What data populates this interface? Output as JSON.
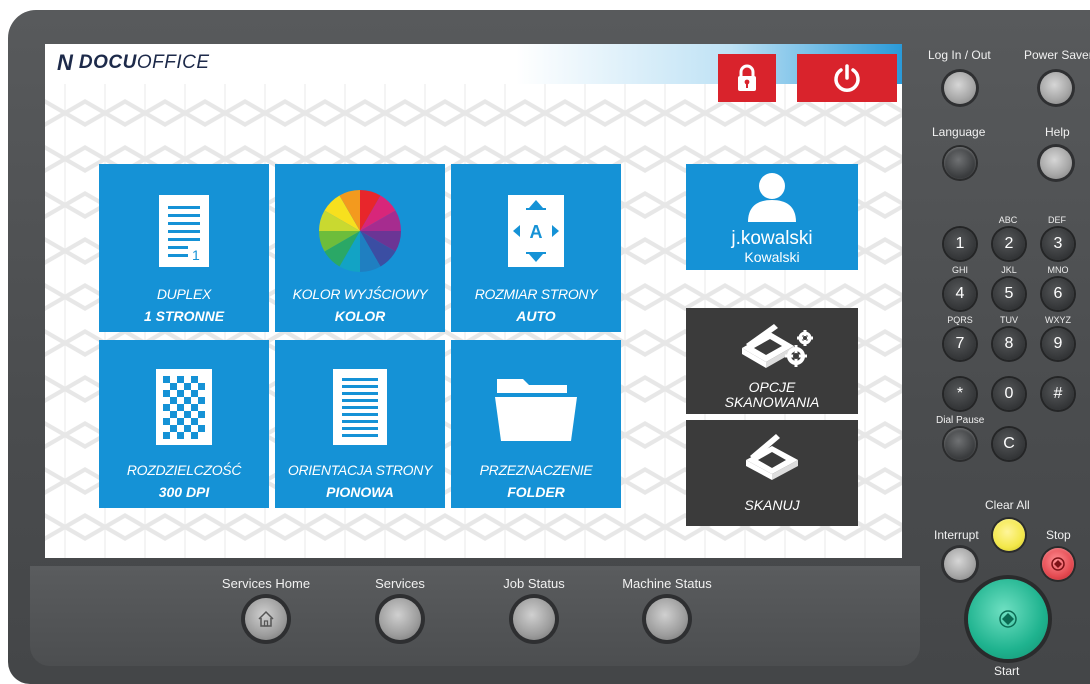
{
  "brand": {
    "mark": "N",
    "name_bold": "DOCU",
    "name_light": "OFFICE"
  },
  "colors": {
    "tile_blue": "#1592d6",
    "danger_red": "#d9232c",
    "dark_tile": "#3b3b3b",
    "clear_all_yellow": "#f3e84a",
    "start_green": "#1fb38f",
    "stop_red": "#e44b52"
  },
  "header": {
    "lock_icon": "lock-icon",
    "power_icon": "power-icon"
  },
  "tiles": [
    {
      "label": "DUPLEX",
      "value": "1 STRONNE",
      "icon": "duplex-document-icon"
    },
    {
      "label": "KOLOR WYJŚCIOWY",
      "value": "KOLOR",
      "icon": "color-wheel-icon"
    },
    {
      "label": "ROZMIAR STRONY",
      "value": "AUTO",
      "icon": "page-size-icon",
      "icon_letter": "A"
    },
    {
      "label": "ROZDZIELCZOŚĆ",
      "value": "300 DPI",
      "icon": "resolution-checker-icon"
    },
    {
      "label": "ORIENTACJA STRONY",
      "value": "PIONOWA",
      "icon": "portrait-page-icon"
    },
    {
      "label": "PRZEZNACZENIE",
      "value": "FOLDER",
      "icon": "folder-icon"
    }
  ],
  "user": {
    "username": "j.kowalski",
    "surname": "Kowalski"
  },
  "scan_options": {
    "line1": "OPCJE",
    "line2": "SKANOWANIA"
  },
  "scan": {
    "label": "SKANUJ"
  },
  "panel": {
    "login_logout": "Log In / Out",
    "power_saver": "Power Saver",
    "language": "Language",
    "help": "Help",
    "dial_pause": "Dial Pause",
    "clear_all": "Clear All",
    "interrupt": "Interrupt",
    "stop": "Stop",
    "start": "Start"
  },
  "keypad": [
    {
      "key": "1",
      "sub": ""
    },
    {
      "key": "2",
      "sub": "ABC"
    },
    {
      "key": "3",
      "sub": "DEF"
    },
    {
      "key": "4",
      "sub": "GHI"
    },
    {
      "key": "5",
      "sub": "JKL"
    },
    {
      "key": "6",
      "sub": "MNO"
    },
    {
      "key": "7",
      "sub": "PQRS"
    },
    {
      "key": "8",
      "sub": "TUV"
    },
    {
      "key": "9",
      "sub": "WXYZ"
    },
    {
      "key": "*",
      "sub": ""
    },
    {
      "key": "0",
      "sub": ""
    },
    {
      "key": "#",
      "sub": ""
    },
    {
      "key": "C",
      "sub": ""
    }
  ],
  "bottom": {
    "services_home": "Services Home",
    "services": "Services",
    "job_status": "Job Status",
    "machine_status": "Machine Status"
  }
}
